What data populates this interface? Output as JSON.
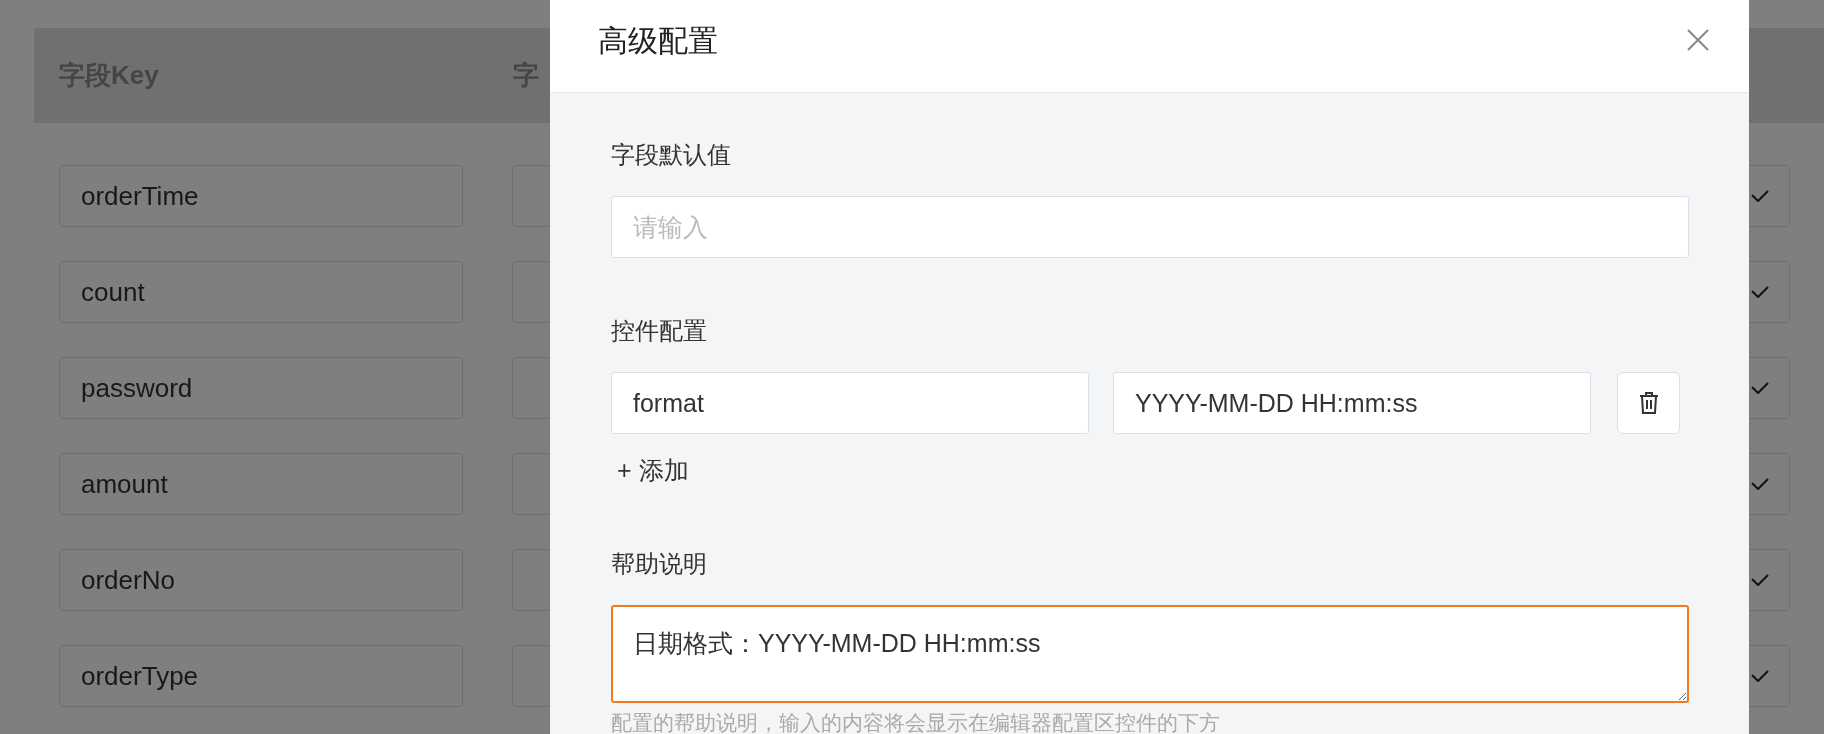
{
  "table": {
    "columns": [
      "字段Key",
      "字"
    ],
    "rows": [
      {
        "key": "orderTime"
      },
      {
        "key": "count"
      },
      {
        "key": "password"
      },
      {
        "key": "amount"
      },
      {
        "key": "orderNo"
      },
      {
        "key": "orderType"
      }
    ]
  },
  "modal": {
    "title": "高级配置",
    "default_value": {
      "label": "字段默认值",
      "placeholder": "请输入"
    },
    "widget_config": {
      "label": "控件配置",
      "params": [
        {
          "key": "format",
          "value": "YYYY-MM-DD HH:mm:ss"
        }
      ],
      "add_label": "+ 添加"
    },
    "help": {
      "label": "帮助说明",
      "value": "日期格式：YYYY-MM-DD HH:mm:ss",
      "focused": true,
      "hint": "配置的帮助说明，输入的内容将会显示在编辑器配置区控件的下方"
    }
  }
}
